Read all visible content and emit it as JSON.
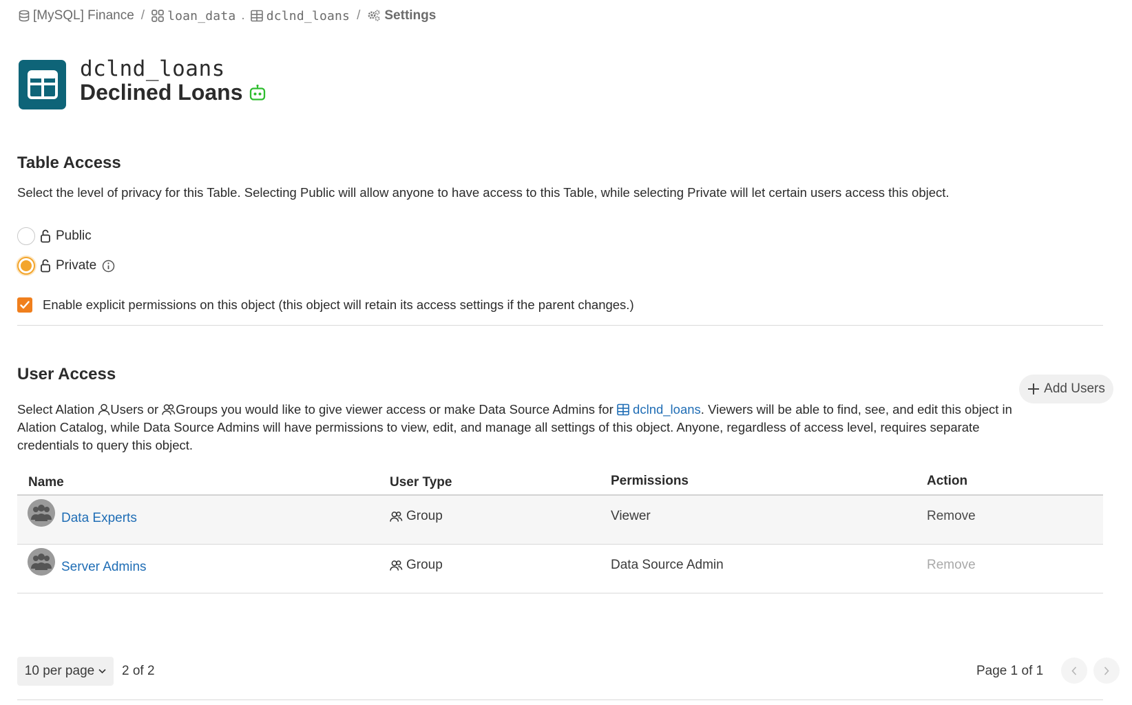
{
  "breadcrumb": {
    "datasource": "[MySQL] Finance",
    "schema": "loan_data",
    "schema_dot": ".",
    "table": "dclnd_loans",
    "settings": "Settings",
    "separator": "/"
  },
  "object": {
    "technical_name": "dclnd_loans",
    "title": "Declined Loans",
    "icon": "table-grid-icon",
    "bot_icon": "robot-icon"
  },
  "table_access": {
    "heading": "Table Access",
    "description": "Select the level of privacy for this Table. Selecting Public will allow anyone to have access to this Table, while selecting Private will let certain users access this object.",
    "public_label": "Public",
    "private_label": "Private",
    "selected": "Private",
    "explicit_permissions_label": "Enable explicit permissions on this object (this object will retain its access settings if the parent changes.)",
    "explicit_permissions_checked": true
  },
  "user_access": {
    "heading": "User Access",
    "add_users_label": "Add Users",
    "desc_part1": "Select Alation ",
    "desc_users": "Users",
    "desc_or": " or ",
    "desc_groups": "Groups",
    "desc_part2": " you would like to give viewer access or make Data Source Admins for ",
    "desc_link": "dclnd_loans",
    "desc_part3": ". Viewers will be able to find, see, and edit this object in",
    "desc_line2": "Alation Catalog, while Data Source Admins will have permissions to view, edit, and manage all settings of this object. Anyone, regardless of access level, requires separate",
    "desc_line3": "credentials to query this object."
  },
  "table": {
    "headers": {
      "name": "Name",
      "user_type": "User Type",
      "permissions": "Permissions",
      "action": "Action"
    },
    "rows": [
      {
        "name": "Data Experts",
        "user_type": "Group",
        "permissions": "Viewer",
        "action": "Remove",
        "action_enabled": true
      },
      {
        "name": "Server Admins",
        "user_type": "Group",
        "permissions": "Data Source Admin",
        "action": "Remove",
        "action_enabled": false
      }
    ]
  },
  "pagination": {
    "per_page": "10 per page",
    "count": "2 of 2",
    "page": "Page 1 of 1"
  },
  "colors": {
    "accent_orange": "#f3a52c",
    "checkbox_orange": "#f07f1d",
    "link_blue": "#1f6db5",
    "table_icon_teal": "#0e6478",
    "bot_green": "#2ebd2e"
  }
}
